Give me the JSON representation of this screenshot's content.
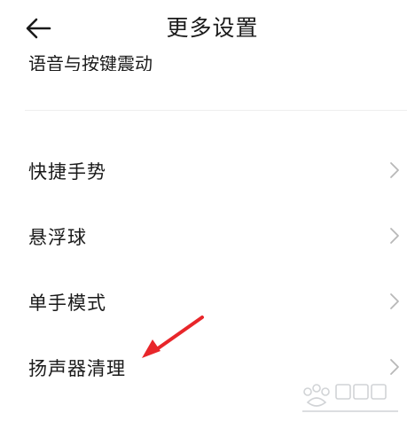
{
  "header": {
    "title": "更多设置",
    "back_icon": "arrow-left-icon"
  },
  "list": {
    "partial_item_label": "语音与按键震动",
    "items": [
      {
        "label": "快捷手势",
        "icon": "chevron-right-icon"
      },
      {
        "label": "悬浮球",
        "icon": "chevron-right-icon"
      },
      {
        "label": "单手模式",
        "icon": "chevron-right-icon"
      },
      {
        "label": "扬声器清理",
        "icon": "chevron-right-icon"
      }
    ]
  },
  "annotation": {
    "icon": "red-arrow-icon",
    "color": "#e8262a"
  },
  "watermark": {
    "icon": "baidu-jingyan-watermark-icon"
  },
  "colors": {
    "text": "#1a1a1a",
    "chevron": "#b8b8b8",
    "divider": "#eeeeee",
    "background": "#ffffff"
  }
}
